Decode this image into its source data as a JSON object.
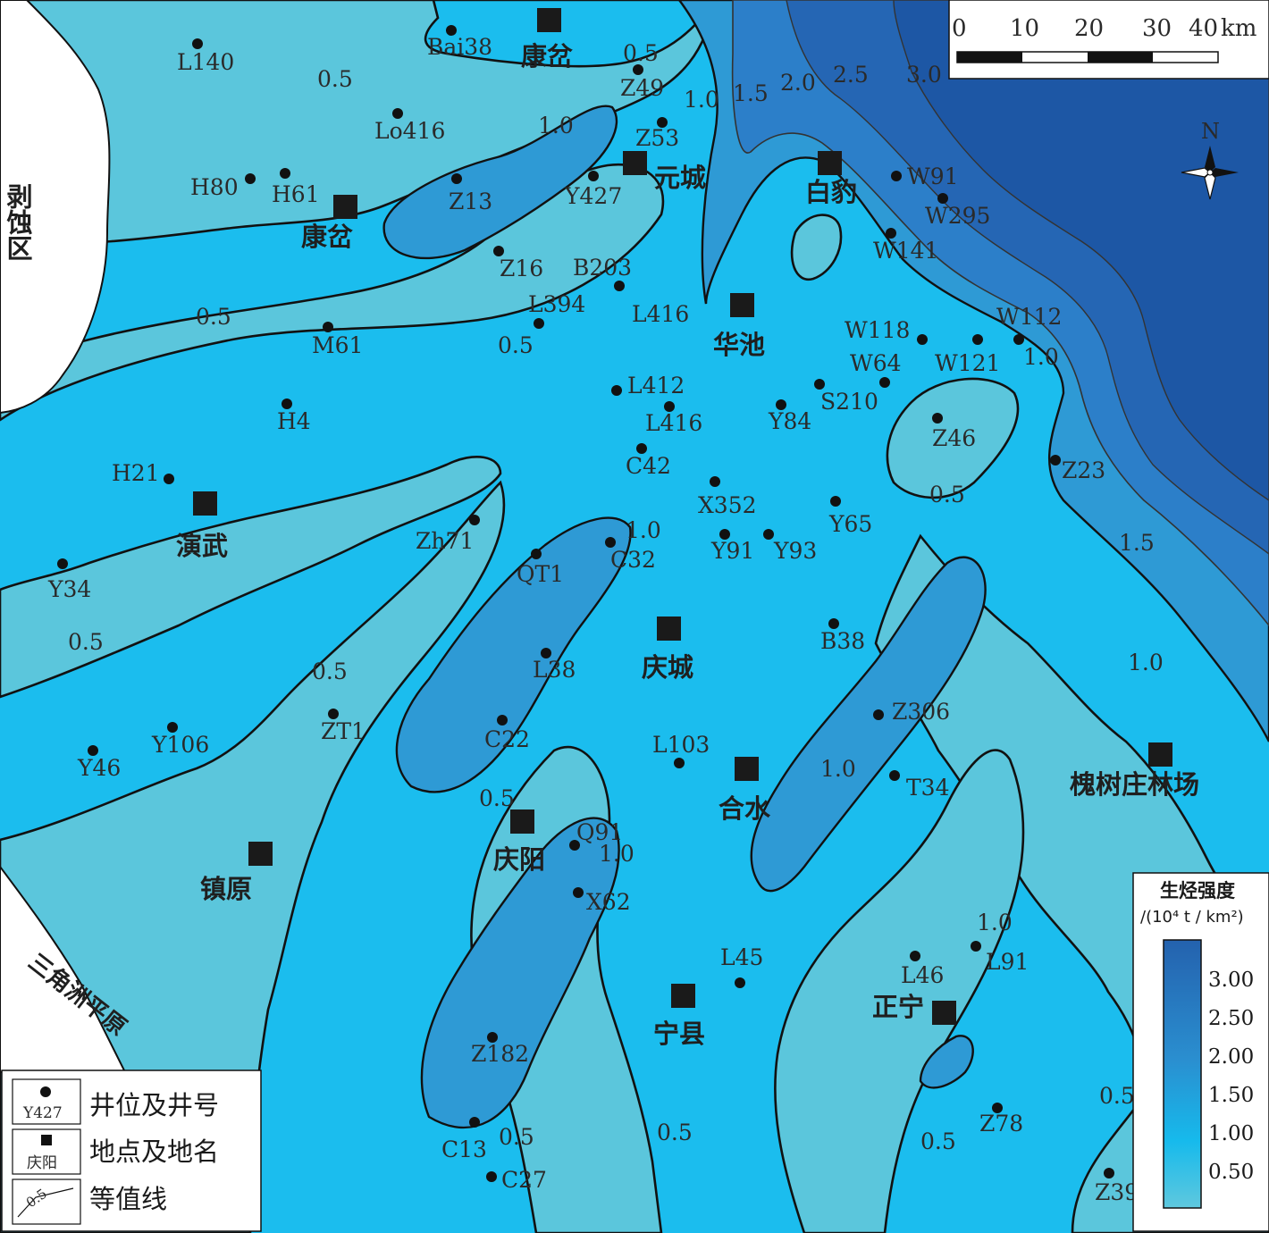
{
  "colors": {
    "band_low": "#5bc6dc",
    "band_mid": "#1bbdee",
    "band_high": "#2e9ad5",
    "band_2": "#2c7fc9",
    "band_3": "#1d57a5",
    "erosion": "#ffffff",
    "contour": "#111111",
    "colorbar_top": "#2462ae",
    "colorbar_bottom": "#5fc8de"
  },
  "region_labels": {
    "erosion_zone": "剥蚀区",
    "delta_plain": "三角洲平原"
  },
  "places": [
    {
      "name": "康岔",
      "id": "kangcha-north"
    },
    {
      "name": "康岔",
      "id": "kangcha-west"
    },
    {
      "name": "元城",
      "id": "yuancheng"
    },
    {
      "name": "白豹",
      "id": "baibao"
    },
    {
      "name": "华池",
      "id": "huachi"
    },
    {
      "name": "演武",
      "id": "yanwu"
    },
    {
      "name": "庆城",
      "id": "qingcheng"
    },
    {
      "name": "合水",
      "id": "heshui"
    },
    {
      "name": "庆阳",
      "id": "qingyang"
    },
    {
      "name": "镇原",
      "id": "zhenyuan"
    },
    {
      "name": "宁县",
      "id": "ningxian"
    },
    {
      "name": "正宁",
      "id": "zhengning"
    },
    {
      "name": "槐树庄林场",
      "id": "huaishuzhuang"
    }
  ],
  "wells": [
    "L140",
    "Bai38",
    "Z49",
    "Lo416",
    "Z53",
    "H80",
    "H61",
    "Z13",
    "Y427",
    "W91",
    "W295",
    "W141",
    "Z16",
    "B203",
    "L394",
    "L416",
    "M61",
    "W118",
    "W112",
    "W64",
    "W121",
    "L412",
    "L416",
    "S210",
    "Y84",
    "H4",
    "Z46",
    "C42",
    "H21",
    "Z23",
    "X352",
    "Zh71",
    "Y65",
    "C32",
    "Y91",
    "Y93",
    "QT1",
    "Y34",
    "B38",
    "L38",
    "ZT1",
    "Y106",
    "C22",
    "L103",
    "Z306",
    "Y46",
    "T34",
    "Q91",
    "X62",
    "L45",
    "L46",
    "L91",
    "Z182",
    "C13",
    "C27",
    "Z78",
    "Z39"
  ],
  "contour_labels": [
    "0.5",
    "0.5",
    "1.0",
    "1.0",
    "1.5",
    "2.0",
    "2.5",
    "3.0",
    "0.5",
    "0.5",
    "1.0",
    "0.5",
    "1.0",
    "1.5",
    "0.5",
    "0.5",
    "1.0",
    "1.0",
    "0.5",
    "1.0",
    "1.0",
    "0.5",
    "0.5",
    "0.5",
    "0.5",
    "0.5",
    "0.5"
  ],
  "scale_bar": {
    "ticks": [
      "0",
      "10",
      "20",
      "30",
      "40"
    ],
    "unit": "km"
  },
  "north_label": "N",
  "legend": {
    "items": [
      {
        "sample": "Y427",
        "label": "井位及井号"
      },
      {
        "sample": "庆阳",
        "label": "地点及地名"
      },
      {
        "sample": "0.5",
        "label": "等值线"
      }
    ]
  },
  "colorbar": {
    "title_line1": "生烃强度",
    "title_line2": "/(10⁴ t / km²)",
    "ticks": [
      "3.00",
      "2.50",
      "2.00",
      "1.50",
      "1.00",
      "0.50"
    ]
  }
}
